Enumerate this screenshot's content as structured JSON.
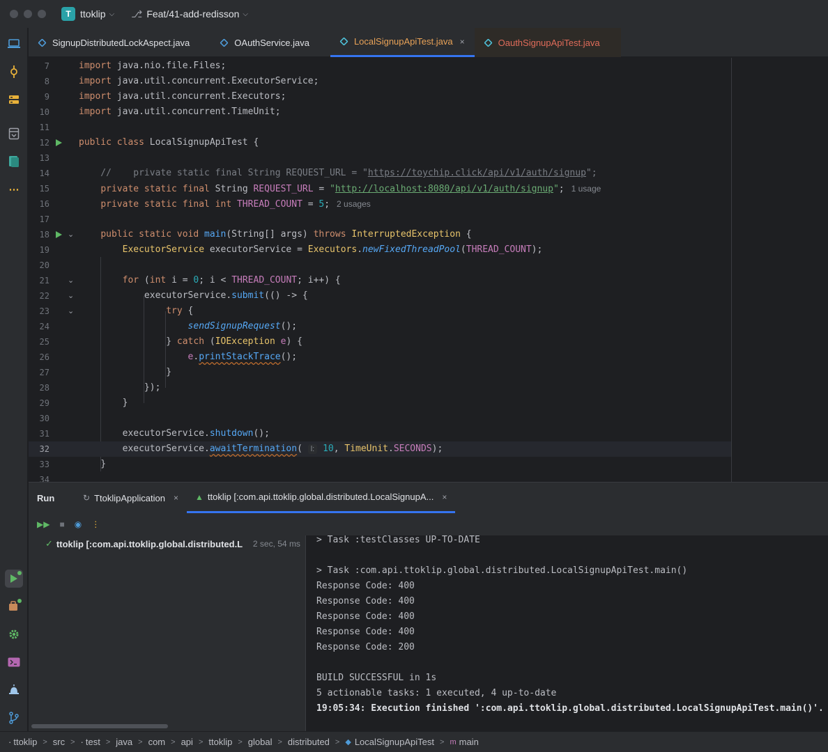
{
  "titlebar": {
    "project_initial": "T",
    "project_name": "ttoklip",
    "branch": "Feat/41-add-redisson"
  },
  "tabs": [
    {
      "label": "SignupDistributedLockAspect.java"
    },
    {
      "label": "OAuthService.java"
    },
    {
      "label": "LocalSignupApiTest.java",
      "close": "×"
    },
    {
      "label": "OauthSignupApiTest.java"
    }
  ],
  "editor": {
    "hint_1usage": "1 usage",
    "hint_2usages": "2 usages",
    "inlay_timeout": "l:"
  },
  "run": {
    "title": "Run",
    "tab1": "TtoklipApplication",
    "tab2": "ttoklip [:com.api.ttoklip.global.distributed.LocalSignupA...",
    "tree_label": "ttoklip [:com.api.ttoklip.global.distributed.L",
    "tree_time": "2 sec, 54 ms",
    "console": [
      "> Task :testClasses UP-TO-DATE",
      "",
      "> Task :com.api.ttoklip.global.distributed.LocalSignupApiTest.main()",
      "Response Code: 400",
      "Response Code: 400",
      "Response Code: 400",
      "Response Code: 400",
      "Response Code: 200",
      "",
      "BUILD SUCCESSFUL in 1s",
      "5 actionable tasks: 1 executed, 4 up-to-date",
      "19:05:34: Execution finished ':com.api.ttoklip.global.distributed.LocalSignupApiTest.main()'."
    ]
  },
  "breadcrumb": [
    "ttoklip",
    "src",
    "test",
    "java",
    "com",
    "api",
    "ttoklip",
    "global",
    "distributed",
    "LocalSignupApiTest",
    "main"
  ],
  "colors": {
    "accent": "#3574f0",
    "success": "#5fb865",
    "active_tab_text": "#e8a257",
    "error_tab_text": "#e06c5a"
  }
}
